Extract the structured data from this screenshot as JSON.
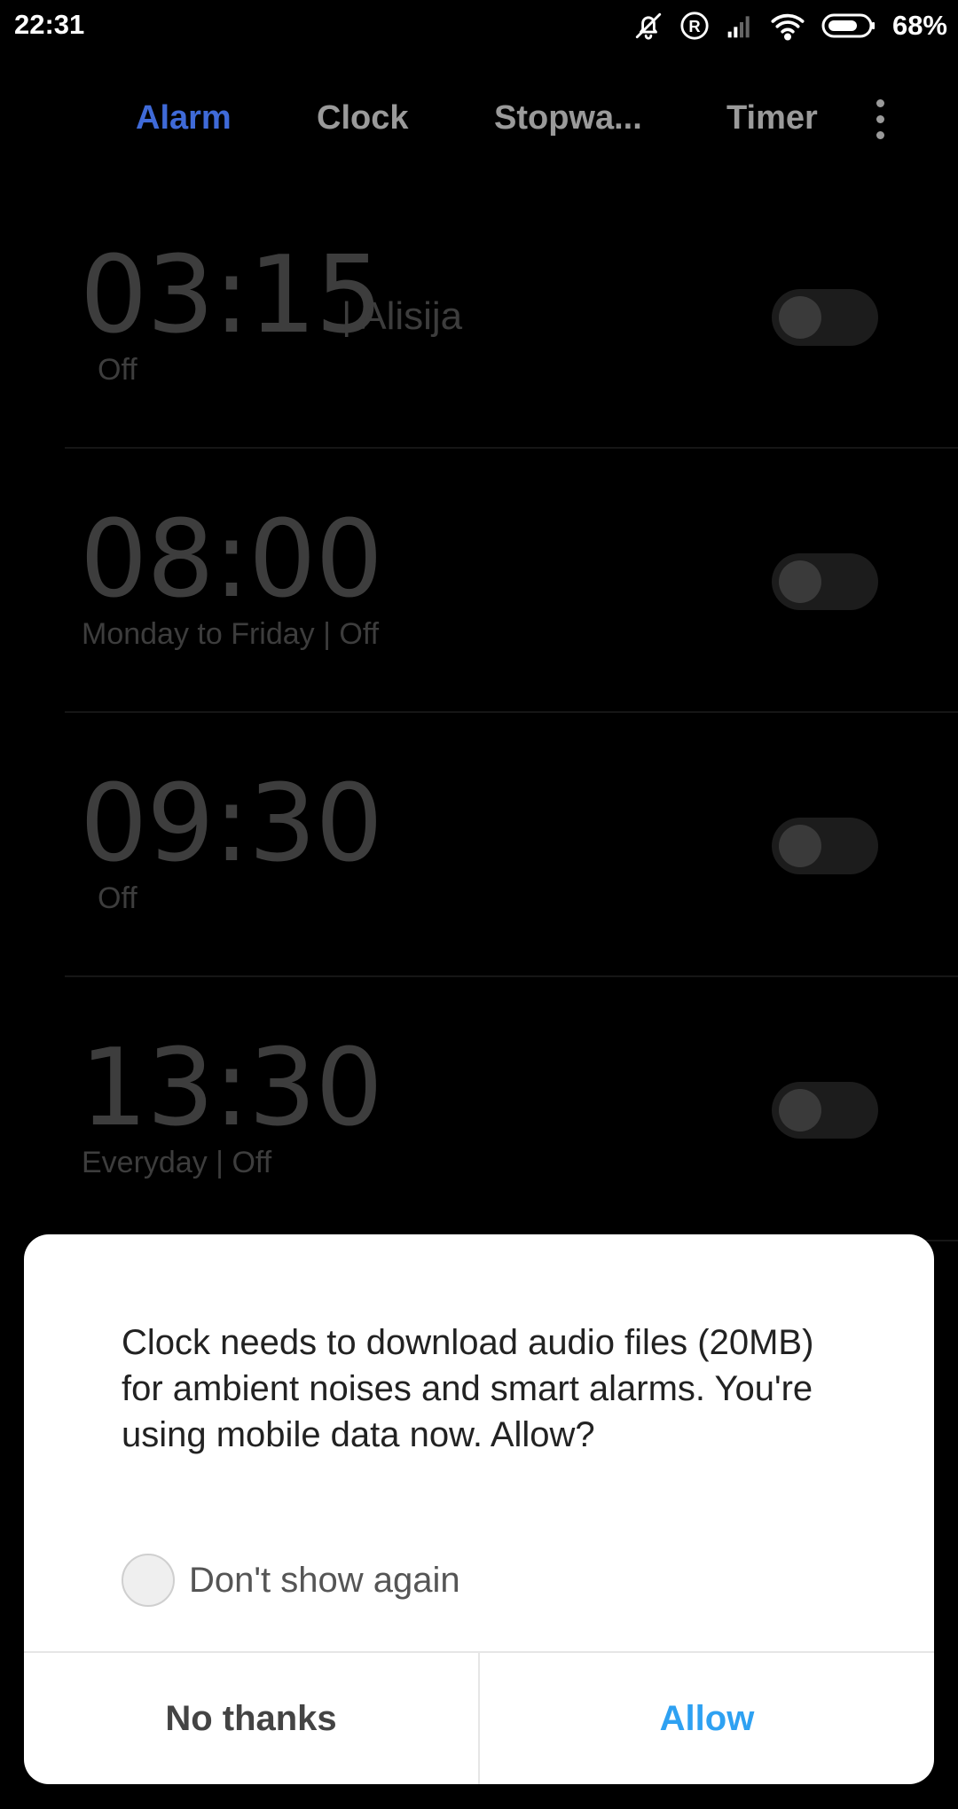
{
  "status_bar": {
    "time": "22:31",
    "battery_percent": "68%",
    "icons": [
      "bell-off-icon",
      "registered-icon",
      "cell-signal-icon",
      "wifi-icon",
      "battery-icon"
    ]
  },
  "tabs": [
    {
      "label": "Alarm",
      "active": true
    },
    {
      "label": "Clock",
      "active": false
    },
    {
      "label": "Stopwa...",
      "active": false
    },
    {
      "label": "Timer",
      "active": false
    }
  ],
  "more_icon": "more-vertical-icon",
  "alarms": [
    {
      "time": "03:15",
      "label": "| Alisija",
      "subtitle": "Off",
      "enabled": false
    },
    {
      "time": "08:00",
      "label": "",
      "subtitle": "Monday to Friday  |  Off",
      "enabled": false
    },
    {
      "time": "09:30",
      "label": "",
      "subtitle": "Off",
      "enabled": false
    },
    {
      "time": "13:30",
      "label": "",
      "subtitle": "Everyday  |  Off",
      "enabled": false
    }
  ],
  "dialog": {
    "message": "Clock needs to download audio files (20MB) for ambient noises and smart alarms. You're using mobile data now. Allow?",
    "checkbox_label": "Don't show again",
    "checkbox_checked": false,
    "negative_label": "No thanks",
    "positive_label": "Allow"
  },
  "colors": {
    "accent_tab": "#3f6ad8",
    "allow_button": "#2ea1f2",
    "background": "#000000"
  }
}
